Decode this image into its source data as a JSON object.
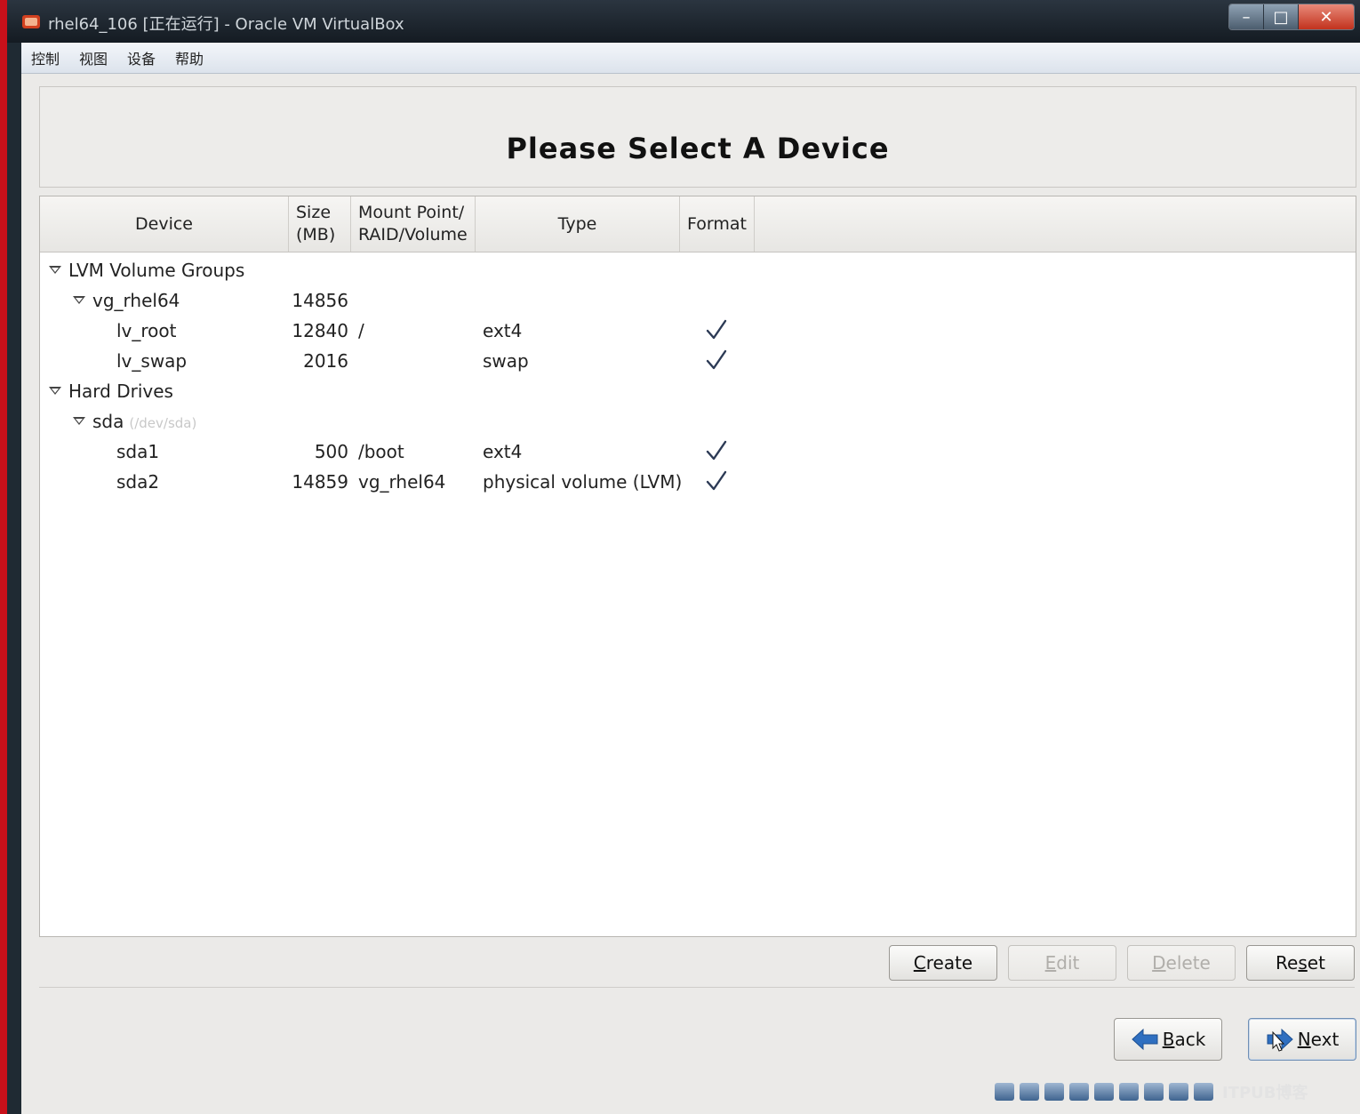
{
  "window": {
    "title": "rhel64_106 [正在运行] - Oracle VM VirtualBox",
    "controls": {
      "minimize": "–",
      "maximize": "□",
      "close": "✕"
    }
  },
  "menubar": [
    "控制",
    "视图",
    "设备",
    "帮助"
  ],
  "banner": {
    "title": "Please Select A Device"
  },
  "table": {
    "headers": {
      "device": "Device",
      "size_line1": "Size",
      "size_line2": "(MB)",
      "mount_line1": "Mount Point/",
      "mount_line2": "RAID/Volume",
      "type": "Type",
      "format": "Format"
    },
    "rows": [
      {
        "device": "LVM Volume Groups",
        "size": "",
        "mount": "",
        "type": "",
        "format": false,
        "expander": true,
        "level": 0,
        "devpath": ""
      },
      {
        "device": "vg_rhel64",
        "size": "14856",
        "mount": "",
        "type": "",
        "format": false,
        "expander": true,
        "level": 1,
        "devpath": ""
      },
      {
        "device": "lv_root",
        "size": "12840",
        "mount": "/",
        "type": "ext4",
        "format": true,
        "expander": false,
        "level": 2,
        "devpath": ""
      },
      {
        "device": "lv_swap",
        "size": "2016",
        "mount": "",
        "type": "swap",
        "format": true,
        "expander": false,
        "level": 2,
        "devpath": ""
      },
      {
        "device": "Hard Drives",
        "size": "",
        "mount": "",
        "type": "",
        "format": false,
        "expander": true,
        "level": 0,
        "devpath": ""
      },
      {
        "device": "sda",
        "size": "",
        "mount": "",
        "type": "",
        "format": false,
        "expander": true,
        "level": 1,
        "devpath": "(/dev/sda)"
      },
      {
        "device": "sda1",
        "size": "500",
        "mount": "/boot",
        "type": "ext4",
        "format": true,
        "expander": false,
        "level": 2,
        "devpath": ""
      },
      {
        "device": "sda2",
        "size": "14859",
        "mount": "vg_rhel64",
        "type": "physical volume (LVM)",
        "format": true,
        "expander": false,
        "level": 2,
        "devpath": ""
      }
    ]
  },
  "buttons": {
    "create": {
      "mnemonic": "C",
      "rest": "reate"
    },
    "edit": {
      "mnemonic": "E",
      "rest": "dit"
    },
    "delete": {
      "mnemonic": "D",
      "rest": "elete"
    },
    "reset": {
      "pre": "Re",
      "mnemonic": "s",
      "rest": "et"
    },
    "back": {
      "mnemonic": "B",
      "rest": "ack"
    },
    "next": {
      "mnemonic": "N",
      "rest": "ext"
    }
  },
  "watermark": "ITPUB博客",
  "colors": {
    "frame_red": "#c8101a",
    "titlebar": "#1f2a33",
    "menubar": "#dce3ec",
    "vm_bg": "#ebeae8",
    "check": "#2c3a55"
  }
}
